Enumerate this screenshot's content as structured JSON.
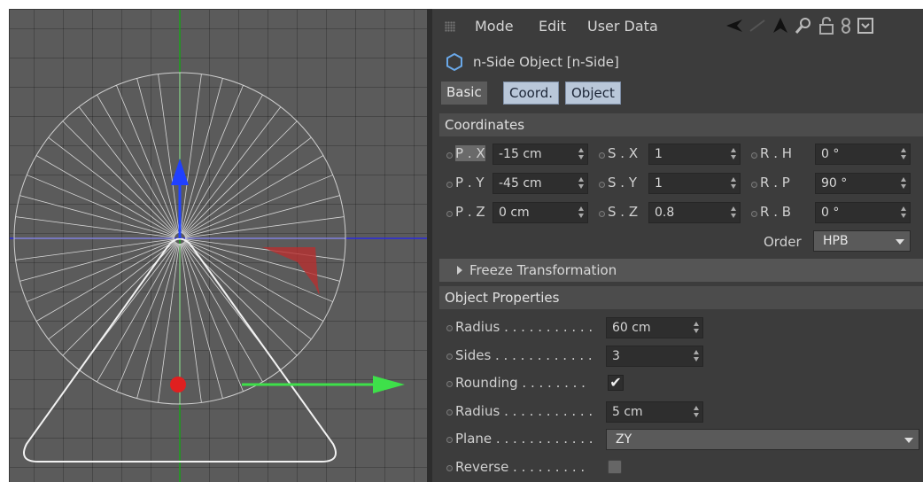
{
  "menu": {
    "mode": "Mode",
    "edit": "Edit",
    "user_data": "User Data"
  },
  "object_title": "n-Side Object [n-Side]",
  "tabs": {
    "basic": "Basic",
    "coord": "Coord.",
    "object": "Object"
  },
  "coordinates": {
    "header": "Coordinates",
    "rows": [
      {
        "p_label": "P . X",
        "p_value": "-15 cm",
        "s_label": "S . X",
        "s_value": "1",
        "r_label": "R . H",
        "r_value": "0 °"
      },
      {
        "p_label": "P . Y",
        "p_value": "-45 cm",
        "s_label": "S . Y",
        "s_value": "1",
        "r_label": "R . P",
        "r_value": "90 °"
      },
      {
        "p_label": "P . Z",
        "p_value": "0 cm",
        "s_label": "S . Z",
        "s_value": "0.8",
        "r_label": "R . B",
        "r_value": "0 °"
      }
    ],
    "order_label": "Order",
    "order_value": "HPB"
  },
  "freeze_label": "Freeze Transformation",
  "object_properties": {
    "header": "Object Properties",
    "radius_label": "Radius . . . . . . . . . . .",
    "radius_value": "60 cm",
    "sides_label": "Sides . . . . . . . . . . . .",
    "sides_value": "3",
    "rounding_label": "Rounding . . . . . . . .",
    "rounding_checked": true,
    "rounding_check_glyph": "✔",
    "radius2_label": "Radius . . . . . . . . . . .",
    "radius2_value": "5 cm",
    "plane_label": "Plane . . . . . . . . . . . .",
    "plane_value": "ZY",
    "reverse_label": "Reverse . . . . . . . . .",
    "reverse_checked": false
  },
  "icons": [
    "grip-icon",
    "back-arrow-icon",
    "up-arrow-icon",
    "search-icon",
    "lock-icon",
    "link-icon",
    "expand-icon",
    "n-side-object-icon"
  ],
  "colors": {
    "axis_x": "#3ee04a",
    "axis_y": "#2040e0",
    "axis_z_dot": "#e02020",
    "guide_green": "#1fa31f",
    "guide_blue": "#2a2adf",
    "tab_selected": "#b9c7d9"
  }
}
